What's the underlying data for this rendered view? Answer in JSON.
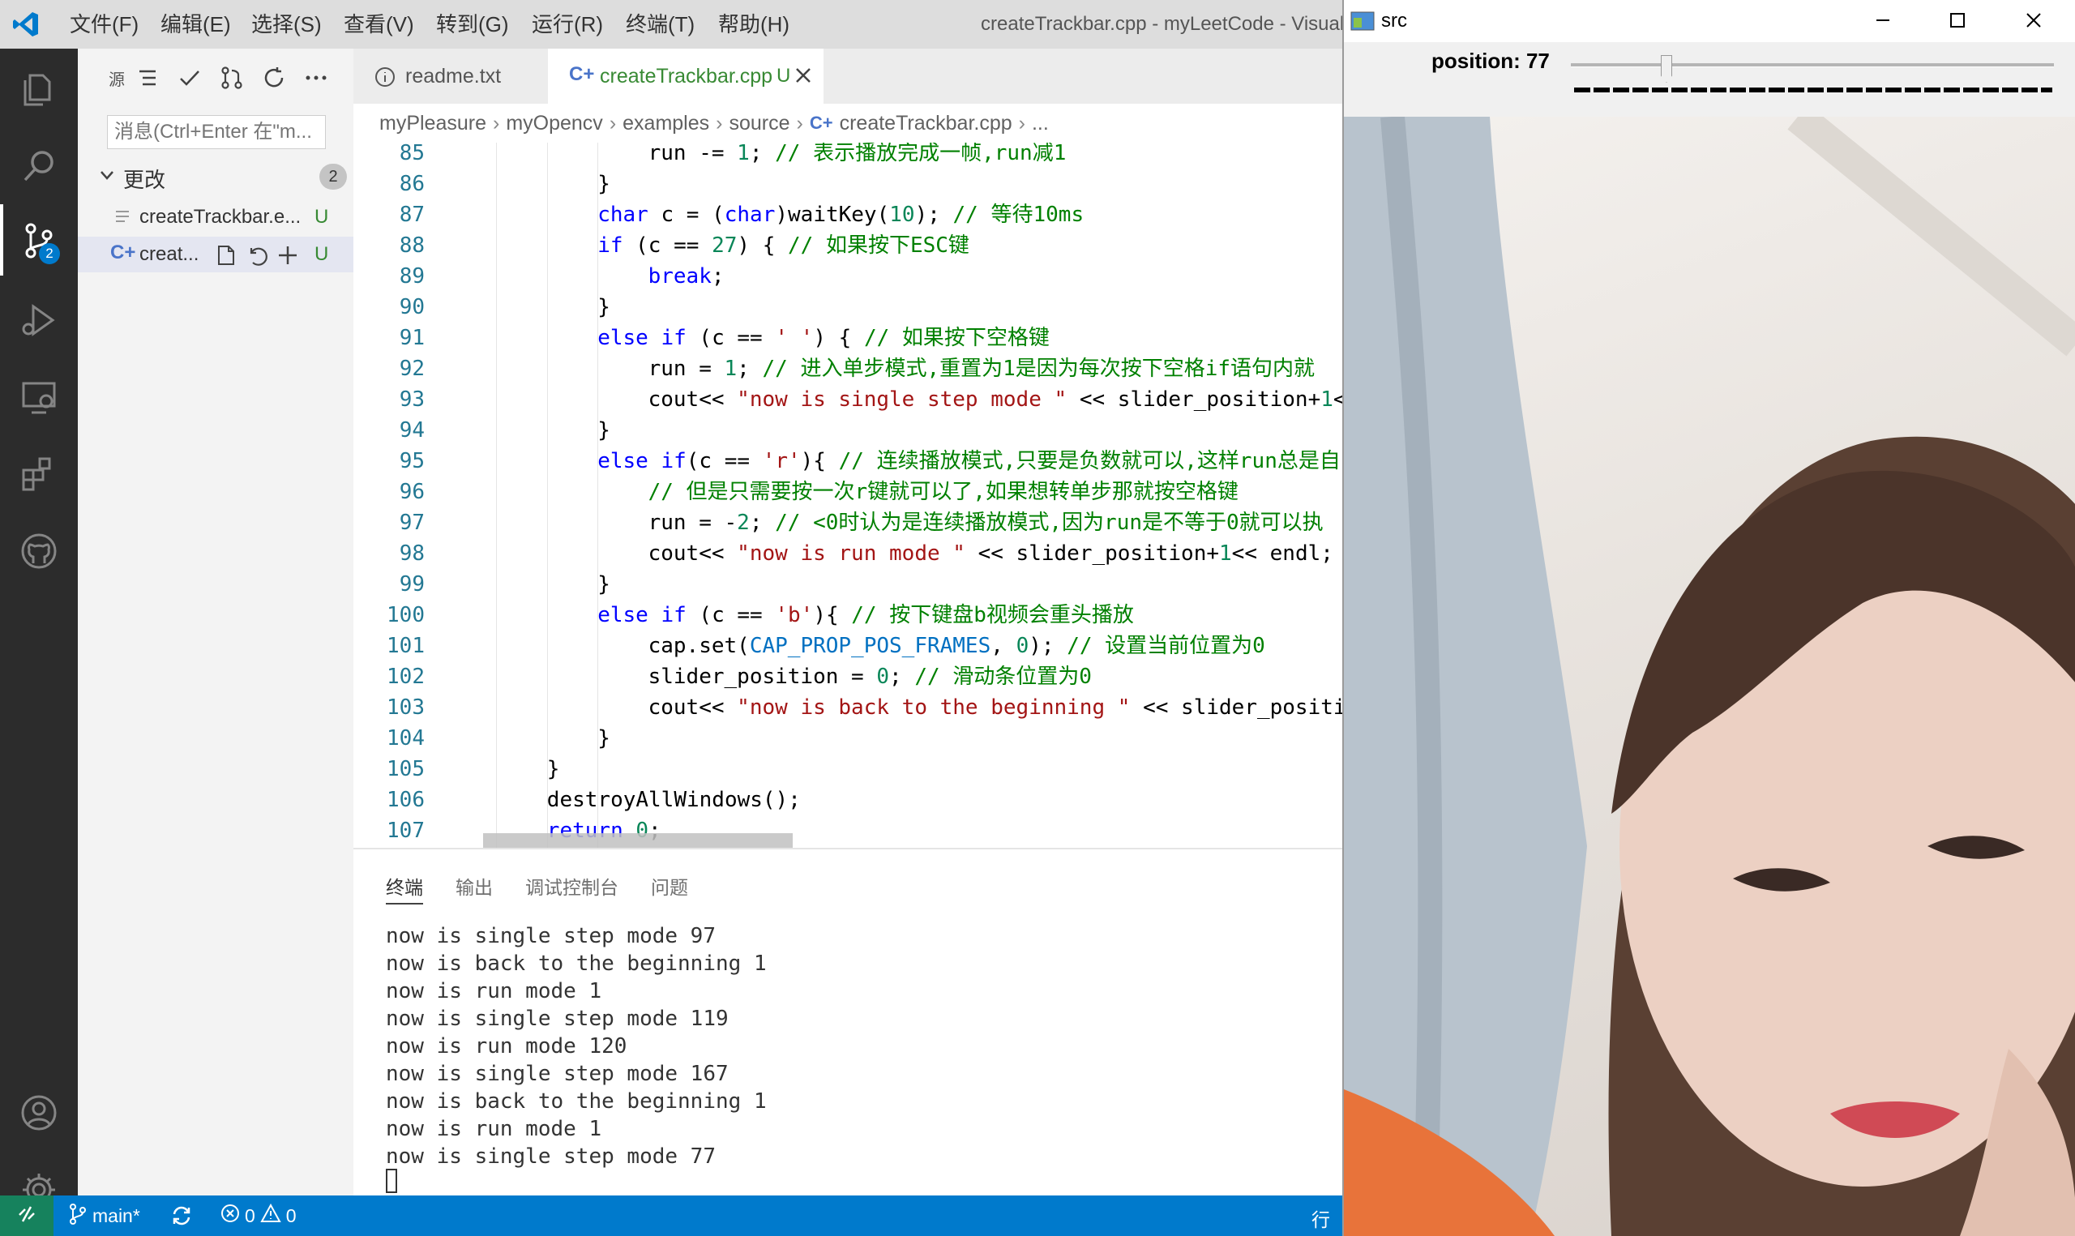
{
  "menu": [
    "文件(F)",
    "编辑(E)",
    "选择(S)",
    "查看(V)",
    "转到(G)",
    "运行(R)",
    "终端(T)",
    "帮助(H)"
  ],
  "window_title": "createTrackbar.cpp - myLeetCode - Visual",
  "activity_bar": {
    "scm_badge": "2"
  },
  "sidebar": {
    "header_icons": [
      "list-icon",
      "check-icon",
      "branch-icon",
      "refresh-icon",
      "more-icon"
    ],
    "header_truncated": "源",
    "message_placeholder": "消息(Ctrl+Enter 在\"m...",
    "changes_label": "更改",
    "changes_count": "2",
    "files": [
      {
        "name": "createTrackbar.e...",
        "status": "U"
      },
      {
        "name": "creat...",
        "status": "U"
      }
    ]
  },
  "tabs": [
    {
      "label": "readme.txt",
      "active": false
    },
    {
      "label": "createTrackbar.cpp",
      "status": "U",
      "active": true
    }
  ],
  "breadcrumb": [
    "myPleasure",
    "myOpencv",
    "examples",
    "source",
    "createTrackbar.cpp",
    "..."
  ],
  "code": [
    {
      "n": "85",
      "indent": 4,
      "tokens": [
        [
          "",
          "run -= "
        ],
        [
          "num",
          "1"
        ],
        [
          "",
          "; "
        ],
        [
          "cm",
          "// 表示播放完成一帧,run减1"
        ]
      ]
    },
    {
      "n": "86",
      "indent": 3,
      "tokens": [
        [
          "",
          "}"
        ]
      ]
    },
    {
      "n": "87",
      "indent": 3,
      "tokens": [
        [
          "kw",
          "char"
        ],
        [
          "",
          " c = ("
        ],
        [
          "kw",
          "char"
        ],
        [
          "",
          ")waitKey("
        ],
        [
          "num",
          "10"
        ],
        [
          "",
          "); "
        ],
        [
          "cm",
          "// 等待10ms"
        ]
      ]
    },
    {
      "n": "88",
      "indent": 3,
      "tokens": [
        [
          "kw",
          "if"
        ],
        [
          "",
          " (c == "
        ],
        [
          "num",
          "27"
        ],
        [
          "",
          ") { "
        ],
        [
          "cm",
          "// 如果按下ESC键"
        ]
      ]
    },
    {
      "n": "89",
      "indent": 4,
      "tokens": [
        [
          "kw",
          "break"
        ],
        [
          "",
          ";"
        ]
      ]
    },
    {
      "n": "90",
      "indent": 3,
      "tokens": [
        [
          "",
          "}"
        ]
      ]
    },
    {
      "n": "91",
      "indent": 3,
      "tokens": [
        [
          "kw",
          "else if"
        ],
        [
          "",
          " (c == "
        ],
        [
          "str",
          "' '"
        ],
        [
          "",
          ") { "
        ],
        [
          "cm",
          "// 如果按下空格键"
        ]
      ]
    },
    {
      "n": "92",
      "indent": 4,
      "tokens": [
        [
          "",
          "run = "
        ],
        [
          "num",
          "1"
        ],
        [
          "",
          "; "
        ],
        [
          "cm",
          "// 进入单步模式,重置为1是因为每次按下空格if语句内就"
        ]
      ]
    },
    {
      "n": "93",
      "indent": 4,
      "tokens": [
        [
          "",
          "cout<< "
        ],
        [
          "str",
          "\"now is single step mode \""
        ],
        [
          "",
          " << slider_position+"
        ],
        [
          "num",
          "1"
        ],
        [
          "",
          "<<"
        ]
      ]
    },
    {
      "n": "94",
      "indent": 3,
      "tokens": [
        [
          "",
          "}"
        ]
      ]
    },
    {
      "n": "95",
      "indent": 3,
      "tokens": [
        [
          "kw",
          "else if"
        ],
        [
          "",
          "(c == "
        ],
        [
          "str",
          "'r'"
        ],
        [
          "",
          "){ "
        ],
        [
          "cm",
          "// 连续播放模式,只要是负数就可以,这样run总是自"
        ]
      ]
    },
    {
      "n": "96",
      "indent": 4,
      "tokens": [
        [
          "cm",
          "// 但是只需要按一次r键就可以了,如果想转单步那就按空格键"
        ]
      ]
    },
    {
      "n": "97",
      "indent": 4,
      "tokens": [
        [
          "",
          "run = -"
        ],
        [
          "num",
          "2"
        ],
        [
          "",
          "; "
        ],
        [
          "cm",
          "// <0时认为是连续播放模式,因为run是不等于0就可以执"
        ]
      ]
    },
    {
      "n": "98",
      "indent": 4,
      "tokens": [
        [
          "",
          "cout<< "
        ],
        [
          "str",
          "\"now is run mode \""
        ],
        [
          "",
          " << slider_position+"
        ],
        [
          "num",
          "1"
        ],
        [
          "",
          "<< endl; //"
        ]
      ]
    },
    {
      "n": "99",
      "indent": 3,
      "tokens": [
        [
          "",
          "}"
        ]
      ]
    },
    {
      "n": "100",
      "indent": 3,
      "tokens": [
        [
          "kw",
          "else if"
        ],
        [
          "",
          " (c == "
        ],
        [
          "str",
          "'b'"
        ],
        [
          "",
          "){ "
        ],
        [
          "cm",
          "// 按下键盘b视频会重头播放"
        ]
      ]
    },
    {
      "n": "101",
      "indent": 4,
      "tokens": [
        [
          "",
          "cap.set("
        ],
        [
          "mac",
          "CAP_PROP_POS_FRAMES"
        ],
        [
          "",
          ", "
        ],
        [
          "num",
          "0"
        ],
        [
          "",
          "); "
        ],
        [
          "cm",
          "// 设置当前位置为0"
        ]
      ]
    },
    {
      "n": "102",
      "indent": 4,
      "tokens": [
        [
          "",
          "slider_position = "
        ],
        [
          "num",
          "0"
        ],
        [
          "",
          "; "
        ],
        [
          "cm",
          "// 滑动条位置为0"
        ]
      ]
    },
    {
      "n": "103",
      "indent": 4,
      "tokens": [
        [
          "",
          "cout<< "
        ],
        [
          "str",
          "\"now is back to the beginning \""
        ],
        [
          "",
          " << slider_positior"
        ]
      ]
    },
    {
      "n": "104",
      "indent": 3,
      "tokens": [
        [
          "",
          "}"
        ]
      ]
    },
    {
      "n": "105",
      "indent": 2,
      "tokens": [
        [
          "",
          "}"
        ]
      ]
    },
    {
      "n": "106",
      "indent": 2,
      "tokens": [
        [
          "",
          "destroyAllWindows();"
        ]
      ]
    },
    {
      "n": "107",
      "indent": 2,
      "tokens": [
        [
          "kw",
          "return"
        ],
        [
          "",
          " "
        ],
        [
          "num",
          "0"
        ],
        [
          "",
          ";"
        ]
      ]
    }
  ],
  "panel": {
    "tabs": [
      "终端",
      "输出",
      "调试控制台",
      "问题"
    ],
    "terminal_lines": [
      "now is single step mode 97",
      "now is back to the beginning 1",
      "now is run mode 1",
      "now is single step mode 119",
      "now is run mode 120",
      "now is single step mode 167",
      "now is back to the beginning 1",
      "now is run mode 1",
      "now is single step mode 77"
    ]
  },
  "statusbar": {
    "branch": "main*",
    "errors": "0",
    "warnings": "0",
    "right_text": "行"
  },
  "src_window": {
    "title": "src",
    "trackbar_label": "position: 77",
    "trackbar_value": 77
  },
  "colors": {
    "activity_bg": "#2c2c2c",
    "status_bg": "#007acc",
    "accent": "#007acc",
    "keyword": "#0000ff",
    "comment": "#008000",
    "string": "#a31515",
    "number": "#098658"
  }
}
